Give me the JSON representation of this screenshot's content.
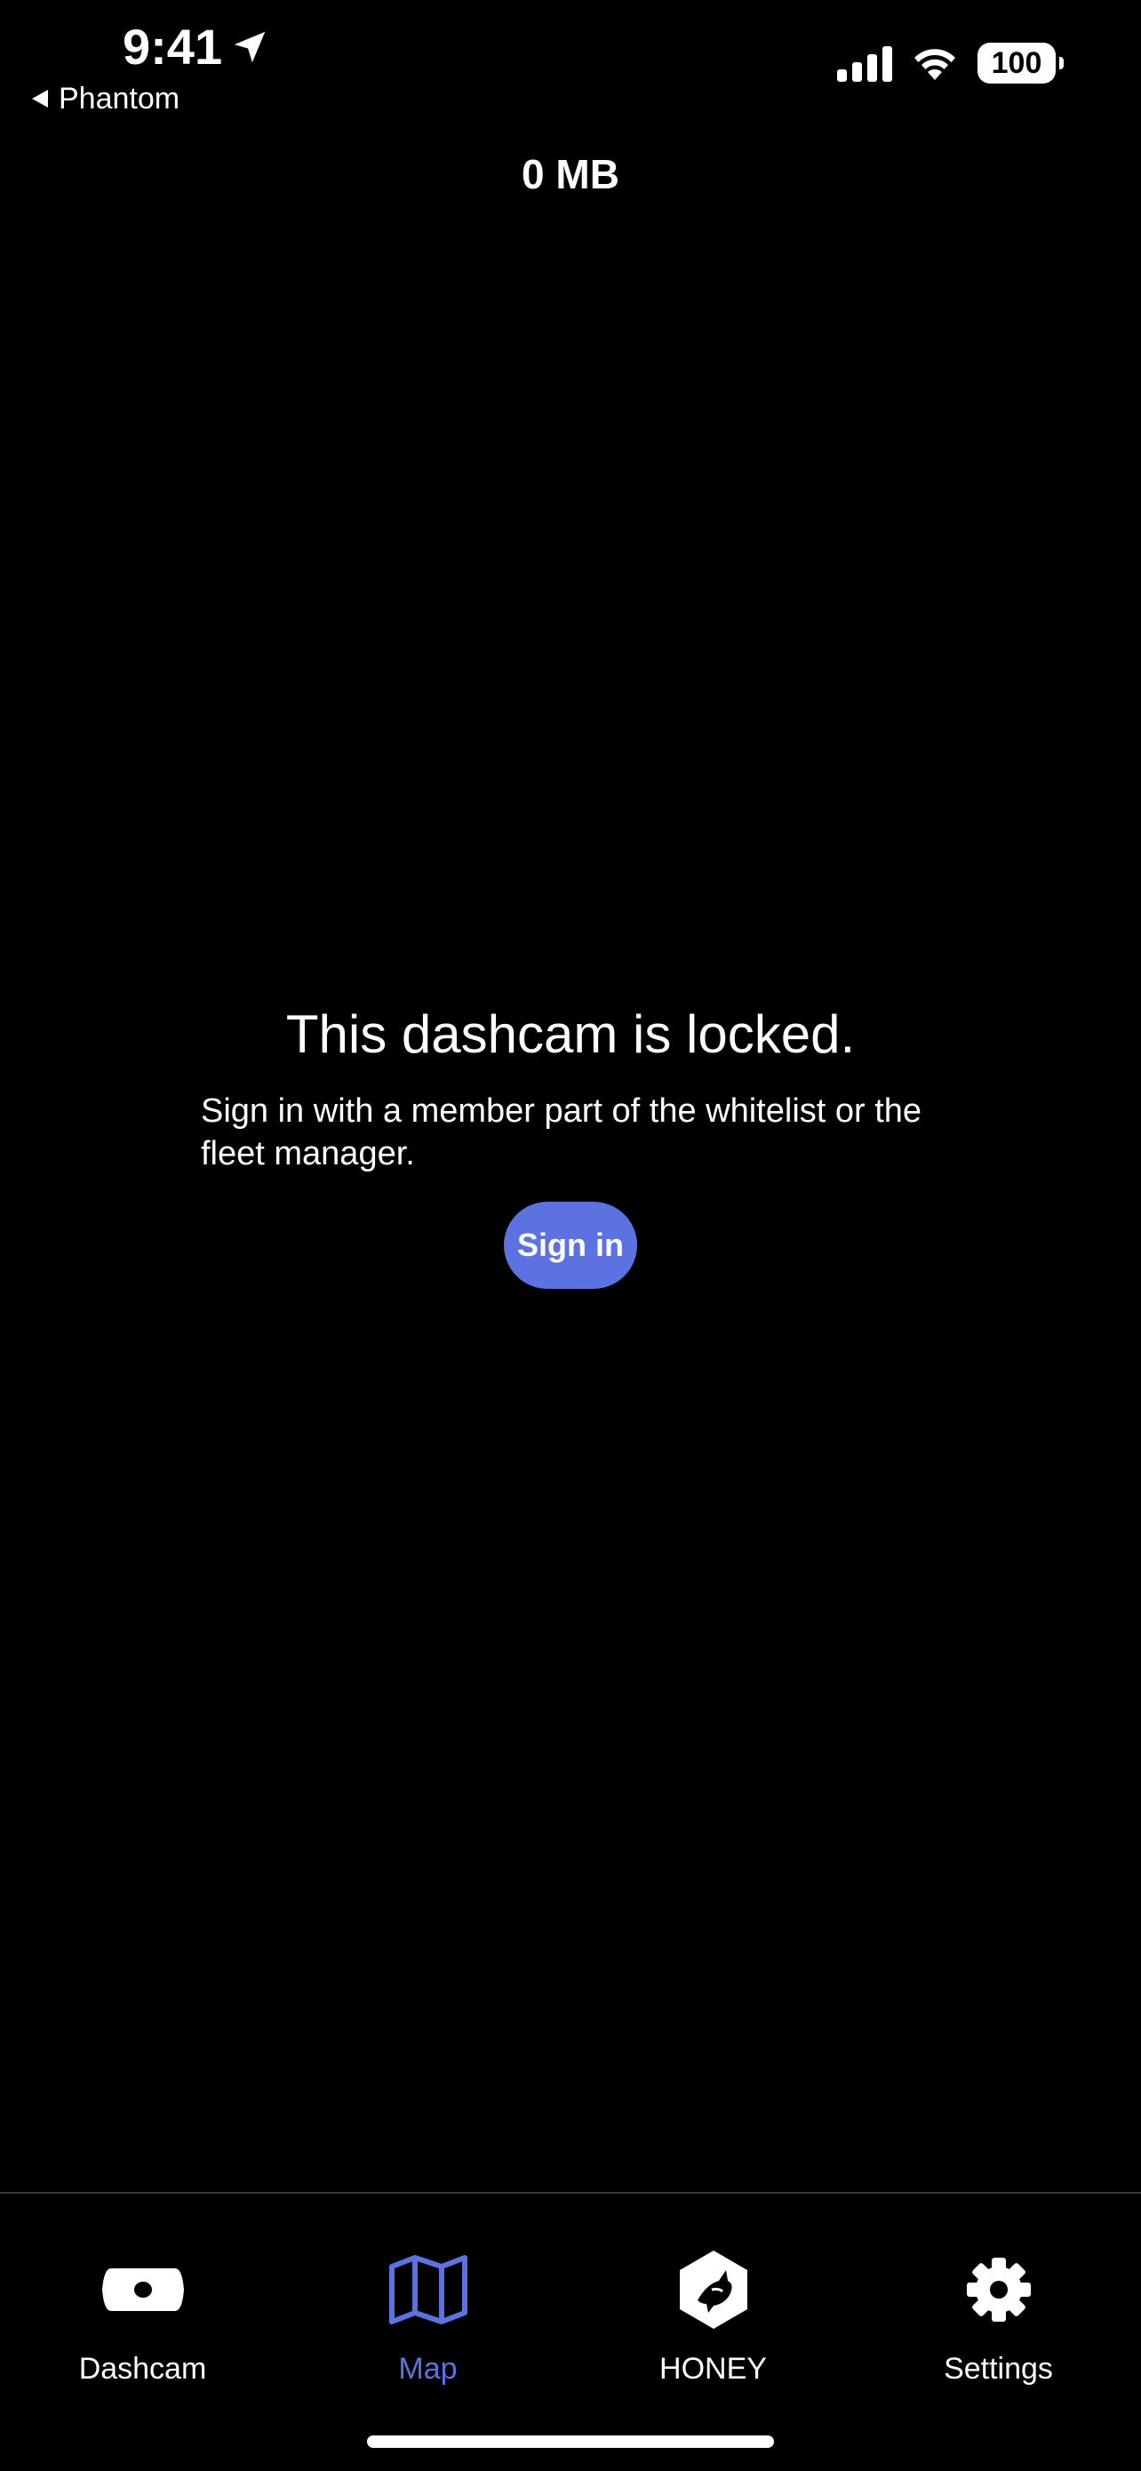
{
  "status_bar": {
    "time": "9:41",
    "back_label": "Phantom",
    "battery": "100"
  },
  "header": {
    "title": "0 MB"
  },
  "locked": {
    "title": "This dashcam is locked.",
    "description": "Sign in with a member part of the whitelist or the fleet manager.",
    "sign_in_label": "Sign in"
  },
  "tabs": [
    {
      "label": "Dashcam",
      "icon": "dashcam-icon"
    },
    {
      "label": "Map",
      "icon": "map-icon",
      "active": true
    },
    {
      "label": "HONEY",
      "icon": "honey-icon"
    },
    {
      "label": "Settings",
      "icon": "gear-icon"
    }
  ],
  "colors": {
    "background": "#000000",
    "accent": "#5b72e0",
    "text": "#ffffff"
  }
}
